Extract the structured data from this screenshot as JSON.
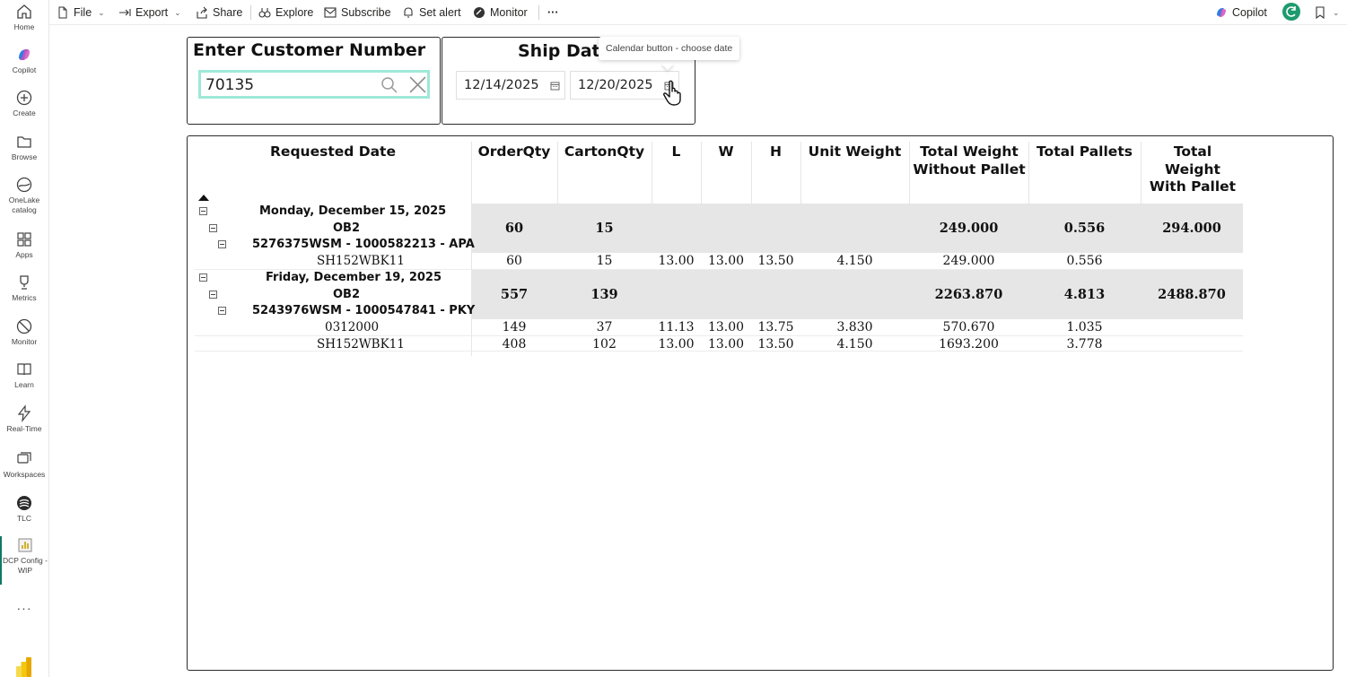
{
  "rail": {
    "items": [
      {
        "label": "Home",
        "icon": "home-icon"
      },
      {
        "label": "Copilot",
        "icon": "copilot-icon"
      },
      {
        "label": "Create",
        "icon": "plus-circle-icon"
      },
      {
        "label": "Browse",
        "icon": "folder-icon"
      },
      {
        "label": "OneLake catalog",
        "icon": "onelake-icon"
      },
      {
        "label": "Apps",
        "icon": "apps-icon"
      },
      {
        "label": "Metrics",
        "icon": "trophy-icon"
      },
      {
        "label": "Monitor",
        "icon": "monitor-icon"
      },
      {
        "label": "Learn",
        "icon": "book-icon"
      },
      {
        "label": "Real-Time",
        "icon": "lightning-icon"
      },
      {
        "label": "Workspaces",
        "icon": "workspaces-icon"
      },
      {
        "label": "TLC",
        "icon": "tlc-logo-icon"
      },
      {
        "label": "DCP Config - WIP",
        "icon": "report-icon"
      }
    ],
    "more": "···"
  },
  "toolbar": {
    "file": "File",
    "export": "Export",
    "share": "Share",
    "explore": "Explore",
    "subscribe": "Subscribe",
    "set_alert": "Set alert",
    "monitor": "Monitor",
    "more": "···",
    "copilot": "Copilot"
  },
  "customer": {
    "title": "Enter Customer Number",
    "value": "70135"
  },
  "ship_date": {
    "title": "Ship Date",
    "start": "12/14/2025",
    "end": "12/20/2025",
    "tooltip": "Calendar button - choose date"
  },
  "table": {
    "headers": {
      "requested_date": "Requested Date",
      "order_qty": "OrderQty",
      "carton_qty": "CartonQty",
      "l": "L",
      "w": "W",
      "h": "H",
      "unit_weight": "Unit Weight",
      "total_weight_without_pallet": "Total Weight Without Pallet",
      "total_pallets": "Total Pallets",
      "total_weight_with_pallet": "Total Weight With Pallet"
    },
    "rows": [
      {
        "label": "Monday, December 15, 2025",
        "order_qty": "",
        "carton_qty": "",
        "l": "",
        "w": "",
        "h": "",
        "unit_weight": "",
        "tw_without": "",
        "pallets": "",
        "tw_with": ""
      },
      {
        "label": "OB2",
        "order_qty": "60",
        "carton_qty": "15",
        "l": "",
        "w": "",
        "h": "",
        "unit_weight": "",
        "tw_without": "249.000",
        "pallets": "0.556",
        "tw_with": "294.000"
      },
      {
        "label": "5276375WSM - 1000582213 - APA",
        "order_qty": "",
        "carton_qty": "",
        "l": "",
        "w": "",
        "h": "",
        "unit_weight": "",
        "tw_without": "",
        "pallets": "",
        "tw_with": ""
      },
      {
        "label": "SH152WBK11",
        "order_qty": "60",
        "carton_qty": "15",
        "l": "13.00",
        "w": "13.00",
        "h": "13.50",
        "unit_weight": "4.150",
        "tw_without": "249.000",
        "pallets": "0.556",
        "tw_with": ""
      },
      {
        "label": "Friday, December 19, 2025",
        "order_qty": "",
        "carton_qty": "",
        "l": "",
        "w": "",
        "h": "",
        "unit_weight": "",
        "tw_without": "",
        "pallets": "",
        "tw_with": ""
      },
      {
        "label": "OB2",
        "order_qty": "557",
        "carton_qty": "139",
        "l": "",
        "w": "",
        "h": "",
        "unit_weight": "",
        "tw_without": "2263.870",
        "pallets": "4.813",
        "tw_with": "2488.870"
      },
      {
        "label": "5243976WSM - 1000547841 - PKY",
        "order_qty": "",
        "carton_qty": "",
        "l": "",
        "w": "",
        "h": "",
        "unit_weight": "",
        "tw_without": "",
        "pallets": "",
        "tw_with": ""
      },
      {
        "label": "0312000",
        "order_qty": "149",
        "carton_qty": "37",
        "l": "11.13",
        "w": "13.00",
        "h": "13.75",
        "unit_weight": "3.830",
        "tw_without": "570.670",
        "pallets": "1.035",
        "tw_with": ""
      },
      {
        "label": "SH152WBK11",
        "order_qty": "408",
        "carton_qty": "102",
        "l": "13.00",
        "w": "13.00",
        "h": "13.50",
        "unit_weight": "4.150",
        "tw_without": "1693.200",
        "pallets": "3.778",
        "tw_with": ""
      }
    ]
  },
  "colors": {
    "accent": "#117865",
    "search_border": "#9ee8d7",
    "row_shade": "#e6e6e6"
  }
}
